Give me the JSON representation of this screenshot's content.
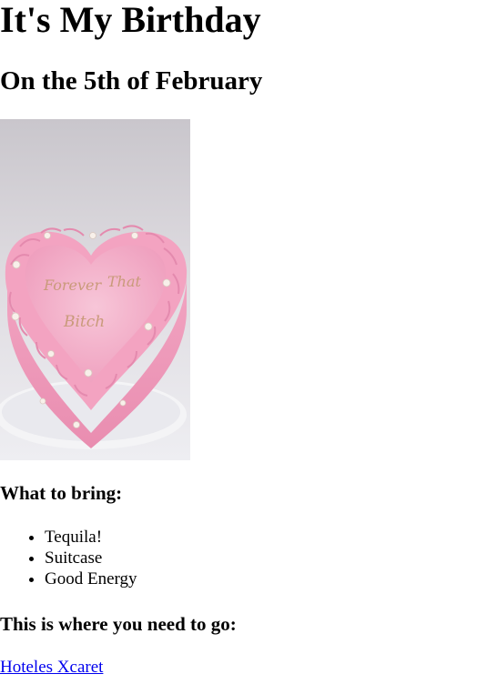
{
  "page": {
    "title": "It's My Birthday",
    "subtitle": "On the 5th of February"
  },
  "image": {
    "description_icon": "heart-cake-image",
    "cake_inscription": "Forever That Bitch"
  },
  "bring": {
    "heading": "What to bring:",
    "items": [
      "Tequila!",
      "Suitcase",
      "Good Energy"
    ]
  },
  "location": {
    "heading": "This is where you need to go:",
    "link_text": "Hoteles Xcaret"
  },
  "colors": {
    "link": "#0000ee",
    "text": "#000000",
    "frosting": "#f4a9c4",
    "background": "#ffffff"
  }
}
